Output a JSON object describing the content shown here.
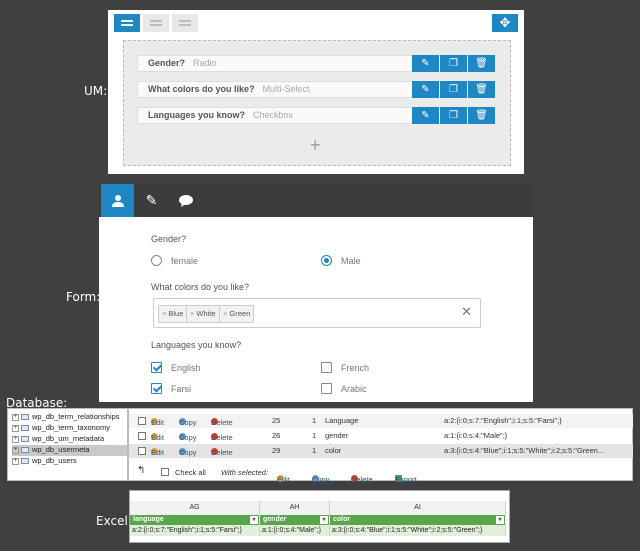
{
  "labels": {
    "um": "UM:",
    "form": "Form:",
    "database": "Database:",
    "excel": "Excel:"
  },
  "um": {
    "fields": [
      {
        "label": "Gender?",
        "type": "Radio"
      },
      {
        "label": "What colors do you like?",
        "type": "Multi-Select"
      },
      {
        "label": "Languages you know?",
        "type": "Checkbox"
      }
    ],
    "add_symbol": "+",
    "move_symbol": "✥",
    "accent": "#1e88c4"
  },
  "form": {
    "gender": {
      "question": "Gender?",
      "options": [
        {
          "label": "female",
          "selected": false
        },
        {
          "label": "Male",
          "selected": true
        }
      ]
    },
    "colors": {
      "question": "What colors do you like?",
      "chips": [
        "Blue",
        "White",
        "Green"
      ],
      "chip_remove": "×",
      "clear": "✕"
    },
    "languages": {
      "question": "Languages you know?",
      "options": [
        {
          "label": "English",
          "checked": true
        },
        {
          "label": "French",
          "checked": false
        },
        {
          "label": "Farsi",
          "checked": true
        },
        {
          "label": "Arabic",
          "checked": false
        }
      ]
    },
    "tab_icons": [
      "user-icon",
      "pencil-icon",
      "speech-bubble-icon"
    ]
  },
  "database": {
    "tables": [
      "wp_db_term_relationships",
      "wp_db_term_taxonomy",
      "wp_db_um_metadata",
      "wp_db_usermeta",
      "wp_db_users"
    ],
    "selected_table": "wp_db_usermeta",
    "actions": {
      "edit": "Edit",
      "copy": "Copy",
      "delete": "Delete"
    },
    "rows": [
      {
        "id": "25",
        "user": "1",
        "key": "Language",
        "value": "a:2:{i:0;s:7:\"English\";i:1;s:5:\"Farsi\";}"
      },
      {
        "id": "26",
        "user": "1",
        "key": "gender",
        "value": "a:1:{i:0;s:4:\"Male\";}"
      },
      {
        "id": "29",
        "user": "1",
        "key": "color",
        "value": "a:3:{i:0;s:4:\"Blue\";i:1;s:5:\"White\";i:2;s:5:\"Green..."
      }
    ],
    "footer": {
      "check_all": "Check all",
      "with_selected": "With selected:",
      "edit": "Edit",
      "copy": "Copy",
      "delete": "Delete",
      "export": "Export"
    }
  },
  "excel": {
    "columns": [
      "AG",
      "AH",
      "AI"
    ],
    "headers": [
      "language",
      "gender",
      "color"
    ],
    "values": [
      "a:2:{i:0;s:7:\"English\";i:1;s:5:\"Farsi\";}",
      "a:1:{i:0;s:4:\"Male\";}",
      "a:3:{i:0;s:4:\"Blue\";i:1;s:5:\"White\";i:2;s:5:\"Green\";}"
    ],
    "header_color": "#5aa64a"
  }
}
